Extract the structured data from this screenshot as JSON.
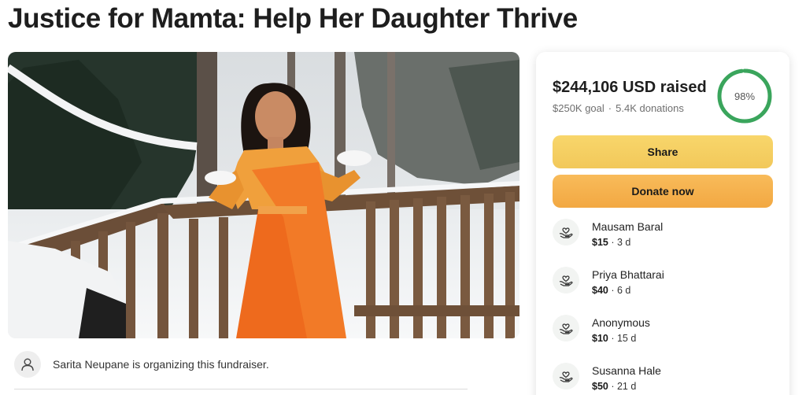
{
  "page": {
    "title": "Justice for Mamta: Help Her Daughter Thrive"
  },
  "organizer": {
    "text": "Sarita Neupane is organizing this fundraiser."
  },
  "campaign": {
    "raised": "$244,106 USD raised",
    "goal": "$250K goal",
    "separator": "·",
    "donations": "5.4K donations",
    "progress_label": "98%",
    "progress_fraction": 0.98
  },
  "buttons": {
    "share": "Share",
    "donate": "Donate now"
  },
  "donors": [
    {
      "name": "Mausam Baral",
      "amount": "$15",
      "time": "· 3 d"
    },
    {
      "name": "Priya Bhattarai",
      "amount": "$40",
      "time": "· 6 d"
    },
    {
      "name": "Anonymous",
      "amount": "$10",
      "time": "· 15 d"
    },
    {
      "name": "Susanna Hale",
      "amount": "$50",
      "time": "· 21 d"
    }
  ],
  "icons": {
    "organizer": "user-icon",
    "donor": "hand-heart-icon"
  },
  "colors": {
    "progress": "#3aa55c",
    "share_button": "#f5cf62",
    "donate_button": "#f5b04b"
  }
}
